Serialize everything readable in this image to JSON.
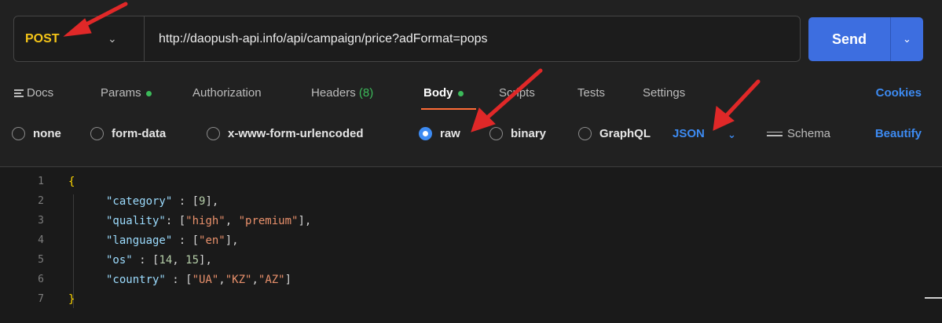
{
  "request": {
    "method": "POST",
    "url": "http://daopush-api.info/api/campaign/price?adFormat=pops",
    "send_label": "Send"
  },
  "tabs": {
    "docs": "Docs",
    "params": "Params",
    "authorization": "Authorization",
    "headers": "Headers",
    "headers_count": "(8)",
    "body": "Body",
    "scripts": "Scripts",
    "tests": "Tests",
    "settings": "Settings",
    "cookies": "Cookies"
  },
  "body_options": {
    "none": "none",
    "form_data": "form-data",
    "x_www": "x-www-form-urlencoded",
    "raw": "raw",
    "binary": "binary",
    "graphql": "GraphQL",
    "format": "JSON",
    "schema": "Schema",
    "beautify": "Beautify"
  },
  "code": {
    "line_numbers": [
      "1",
      "2",
      "3",
      "4",
      "5",
      "6",
      "7"
    ],
    "open_brace": "{",
    "close_brace": "}",
    "k_category": "\"category\"",
    "v_category": "9",
    "k_quality": "\"quality\"",
    "v_quality_1": "\"high\"",
    "v_quality_2": "\"premium\"",
    "k_language": "\"language\"",
    "v_language": "\"en\"",
    "k_os": "\"os\"",
    "v_os_1": "14",
    "v_os_2": "15",
    "k_country": "\"country\"",
    "v_country_1": "\"UA\"",
    "v_country_2": "\"KZ\"",
    "v_country_3": "\"AZ\""
  },
  "colors": {
    "method": "#f5c518",
    "send": "#3d6ee0",
    "accent_blue": "#3d8bf2",
    "annotation_arrow": "#e02828"
  }
}
